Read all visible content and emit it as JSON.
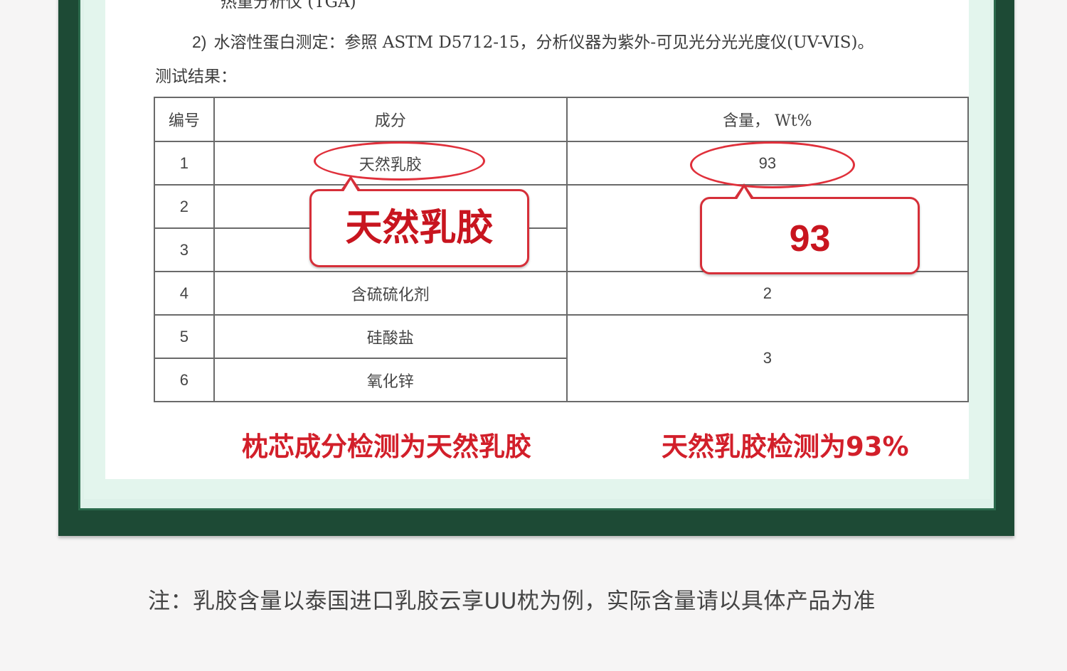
{
  "document": {
    "tga_line": "热重分析仪 (TGA)",
    "item2": {
      "number": "2)",
      "text": "水溶性蛋白测定：参照 ASTM D5712-15，分析仪器为紫外-可见光分光光度仪(UV-VIS)。"
    },
    "results_label": "测试结果：",
    "table": {
      "headers": [
        "编号",
        "成分",
        "含量， Wt%"
      ],
      "rows": [
        {
          "no": "1",
          "component": "天然乳胶",
          "content": "93"
        },
        {
          "no": "2",
          "component": "",
          "content": ""
        },
        {
          "no": "3",
          "component": "",
          "content": ""
        },
        {
          "no": "4",
          "component": "含硫硫化剂",
          "content": "2"
        },
        {
          "no": "5",
          "component": "硅酸盐",
          "content": "3"
        },
        {
          "no": "6",
          "component": "氧化锌",
          "content": ""
        }
      ]
    }
  },
  "annotations": {
    "callout_left": "天然乳胶",
    "callout_right": "93",
    "caption_left": "枕芯成分检测为天然乳胶",
    "caption_right": "天然乳胶检测为93%"
  },
  "footnote": "注：乳胶含量以泰国进口乳胶云享UU枕为例，实际含量请以具体产品为准",
  "colors": {
    "frame_green": "#1d4a35",
    "mint": "#e3f5ed",
    "annotation_red": "#d21f2a",
    "page_bg": "#f6f5f5"
  }
}
